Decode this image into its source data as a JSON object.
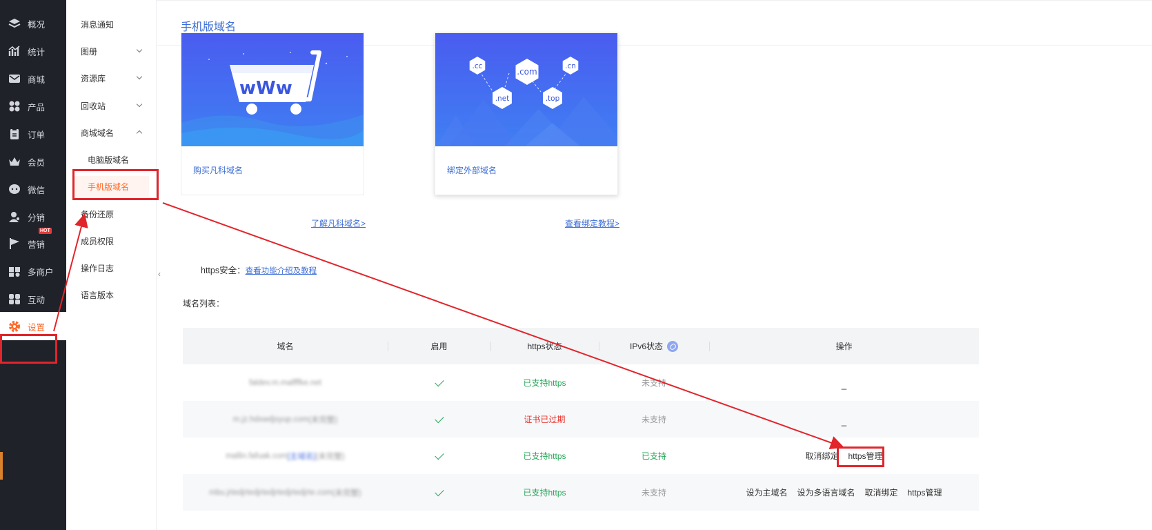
{
  "nav": {
    "items": [
      {
        "label": "概况",
        "icon": "layers-icon"
      },
      {
        "label": "统计",
        "icon": "chart-icon"
      },
      {
        "label": "商城",
        "icon": "mail-icon"
      },
      {
        "label": "产品",
        "icon": "grid-icon"
      },
      {
        "label": "订单",
        "icon": "clipboard-icon"
      },
      {
        "label": "会员",
        "icon": "crown-icon"
      },
      {
        "label": "微信",
        "icon": "chat-icon"
      },
      {
        "label": "分销",
        "icon": "user-icon"
      },
      {
        "label": "营销",
        "icon": "flag-icon",
        "badge": "HOT"
      },
      {
        "label": "多商户",
        "icon": "store-icon"
      },
      {
        "label": "互动",
        "icon": "people-icon"
      },
      {
        "label": "设置",
        "icon": "gear-icon",
        "active": true
      }
    ]
  },
  "subnav": {
    "items": [
      {
        "label": "消息通知"
      },
      {
        "label": "图册"
      },
      {
        "label": "资源库"
      },
      {
        "label": "回收站"
      },
      {
        "label": "商城域名"
      },
      {
        "label": "电脑版域名"
      },
      {
        "label": "手机版域名"
      },
      {
        "label": "备份还原"
      },
      {
        "label": "成员权限"
      },
      {
        "label": "操作日志"
      },
      {
        "label": "语言版本"
      }
    ],
    "collapse_glyph": "‹"
  },
  "page": {
    "title": "手机版域名",
    "cards": [
      {
        "label": "购买凡科域名",
        "help": "了解凡科域名>",
        "banner_text": "wWw"
      },
      {
        "label": "绑定外部域名",
        "help": "查看绑定教程>",
        "bubbles": [
          ".cc",
          ".com",
          ".cn",
          ".net",
          ".top"
        ]
      }
    ],
    "https_label": "https安全：",
    "https_link": "查看功能介绍及教程",
    "list_label": "域名列表："
  },
  "table": {
    "headers": [
      "域名",
      "启用",
      "https状态",
      "IPv6状态",
      "操作"
    ],
    "rows": [
      {
        "domain": "faldev.m.malfffke.net",
        "https": "已支持https",
        "https_status": "ok",
        "ipv6": "未支持",
        "ipv6_status": "no",
        "ops": [],
        "alt": false
      },
      {
        "domain": "m.jz.hdxwdjsyup.com",
        "domain_tag": "(未完整)",
        "https": "证书已过期",
        "https_status": "expired",
        "ipv6": "未支持",
        "ipv6_status": "no",
        "ops": [],
        "alt": true
      },
      {
        "domain": "mallin.fafuak.com",
        "domain_link": "[主域名]",
        "domain_tag": "(未完整)",
        "https": "已支持https",
        "https_status": "ok",
        "ipv6": "已支持",
        "ipv6_status": "ok",
        "ops": [
          "取消绑定",
          "https管理"
        ],
        "alt": false
      },
      {
        "domain": "mbu.jrtedjrtedjrtedjrtedjrtedjrte.com",
        "domain_tag": "(未完整)",
        "https": "已支持https",
        "https_status": "ok",
        "ipv6": "未支持",
        "ipv6_status": "no",
        "ops": [
          "设为主域名",
          "设为多语言域名",
          "取消绑定",
          "https管理"
        ],
        "alt": true
      }
    ],
    "empty_ops": "_"
  },
  "colors": {
    "nav_bg": "#20222a",
    "accent_orange": "#ff6a2a",
    "link_blue": "#3f6fd6",
    "ok_green": "#2aa75a",
    "error_red": "#e8322b",
    "annotation_red": "#e1252b"
  }
}
